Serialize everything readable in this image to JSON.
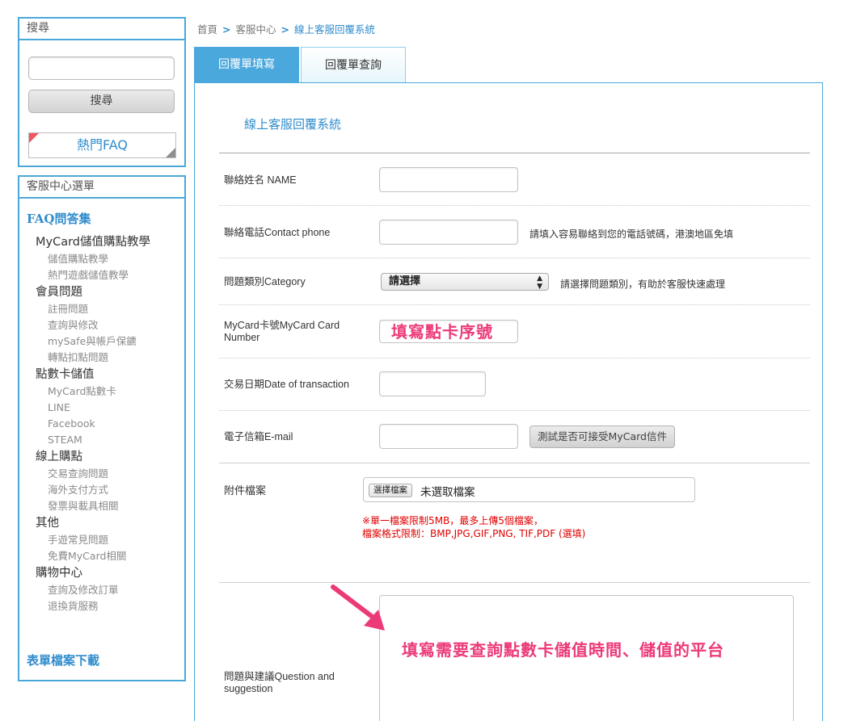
{
  "sidebar": {
    "search": {
      "title": "搜尋",
      "input_value": "",
      "button_label": "搜尋",
      "faq_button_label": "熱門FAQ"
    },
    "menu": {
      "title": "客服中心選單",
      "faq_heading": "FAQ問答集",
      "groups": [
        {
          "label": "MyCard儲值購點教學",
          "items": [
            "儲值購點教學",
            "熱門遊戲儲值教學"
          ]
        },
        {
          "label": "會員問題",
          "items": [
            "註冊問題",
            "查詢與修改",
            "mySafe與帳戶保鑣",
            "轉點扣點問題"
          ]
        },
        {
          "label": "點數卡儲值",
          "items": [
            "MyCard點數卡",
            "LINE",
            "Facebook",
            "STEAM"
          ]
        },
        {
          "label": "線上購點",
          "items": [
            "交易查詢問題",
            "海外支付方式",
            "發票與載具相關"
          ]
        },
        {
          "label": "其他",
          "items": [
            "手遊常見問題",
            "免費MyCard相關"
          ]
        },
        {
          "label": "購物中心",
          "items": [
            "查詢及修改訂單",
            "退換貨服務"
          ]
        }
      ],
      "download_heading": "表單檔案下載"
    }
  },
  "breadcrumb": {
    "home": "首頁",
    "sep": ">",
    "section": "客服中心",
    "current": "線上客服回覆系統"
  },
  "tabs": {
    "active": "回覆單填寫",
    "inactive": "回覆單查詢"
  },
  "form": {
    "title": "線上客服回覆系統",
    "name_label": "聯絡姓名 NAME",
    "name_value": "",
    "phone_label": "聯絡電話Contact phone",
    "phone_value": "",
    "phone_hint": "請填入容易聯絡到您的電話號碼，港澳地區免填",
    "category_label": "問題類別Category",
    "category_selected": "請選擇",
    "category_hint": "請選擇問題類別，有助於客服快速處理",
    "card_label_line1": "MyCard卡號MyCard Card",
    "card_label_line2": "Number",
    "card_annotation": "填寫點卡序號",
    "date_label": "交易日期Date of transaction",
    "date_value": "",
    "email_label": "電子信箱E-mail",
    "email_value": "",
    "email_test_button": "測試是否可接受MyCard信件",
    "attachment_label": "附件檔案",
    "file_button": "選擇檔案",
    "file_status": "未選取檔案",
    "attachment_note_line1": "※單一檔案限制5MB，最多上傳5個檔案，",
    "attachment_note_line2": "檔案格式限制：BMP,JPG,GIF,PNG, TIF,PDF (選填)",
    "question_label_line1": "問題與建議Question and",
    "question_label_line2": "suggestion",
    "question_annotation": "填寫需要查詢點數卡儲值時間、儲值的平台"
  },
  "colors": {
    "accent_blue": "#4ba8dc",
    "link_blue": "#2f8ccc",
    "annotation_pink": "#ec3a79",
    "note_red": "#e00000"
  }
}
